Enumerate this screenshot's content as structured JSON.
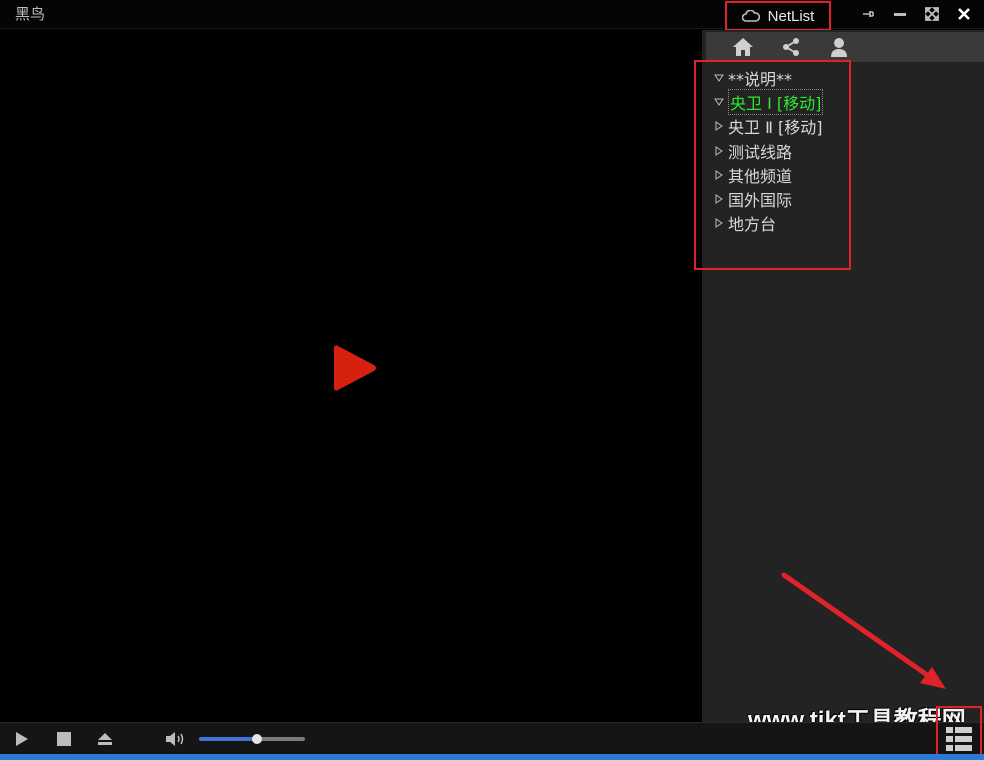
{
  "app": {
    "title": "黑鸟"
  },
  "tab": {
    "label": "NetList",
    "icon": "cloud-icon"
  },
  "window_controls": [
    {
      "name": "pin-icon"
    },
    {
      "name": "minimize-icon"
    },
    {
      "name": "fullscreen-icon"
    },
    {
      "name": "close-icon"
    }
  ],
  "panel": {
    "toolbar": [
      {
        "name": "home-icon"
      },
      {
        "name": "share-icon"
      },
      {
        "name": "user-icon"
      }
    ],
    "channels": [
      {
        "label": "**说明**",
        "expanded": true
      },
      {
        "label": "央卫 Ⅰ [移动]",
        "expanded": true,
        "selected": true
      },
      {
        "label": "央卫 Ⅱ [移动]",
        "expanded": false
      },
      {
        "label": "测试线路",
        "expanded": false
      },
      {
        "label": "其他频道",
        "expanded": false
      },
      {
        "label": "国外国际",
        "expanded": false
      },
      {
        "label": "地方台",
        "expanded": false
      }
    ]
  },
  "playback": {
    "volume": 0.55
  },
  "colors": {
    "accent_red": "#e0222b",
    "play_red": "#e02010",
    "selected_green": "#2ee82e",
    "volume_blue": "#3f73d8"
  },
  "watermark": "www.tikt工具教程网"
}
